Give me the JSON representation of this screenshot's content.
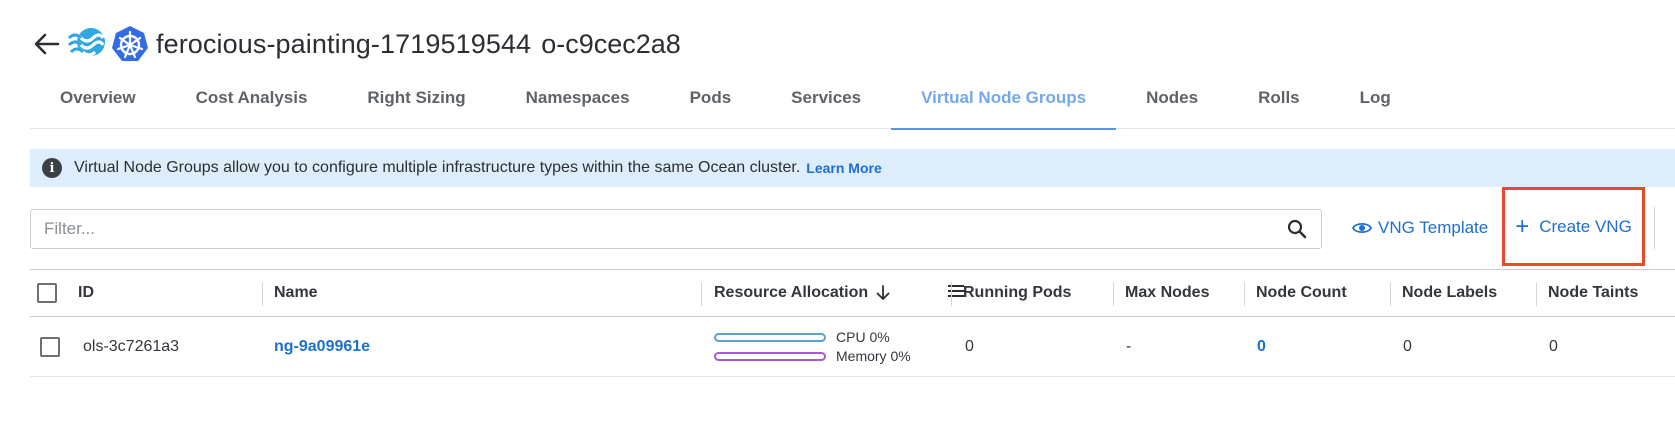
{
  "header": {
    "title": "ferocious-painting-1719519544",
    "subtitle": "o-c9cec2a8"
  },
  "tabs": [
    {
      "label": "Overview"
    },
    {
      "label": "Cost Analysis"
    },
    {
      "label": "Right Sizing"
    },
    {
      "label": "Namespaces"
    },
    {
      "label": "Pods"
    },
    {
      "label": "Services"
    },
    {
      "label": "Virtual Node Groups",
      "active": true
    },
    {
      "label": "Nodes"
    },
    {
      "label": "Rolls"
    },
    {
      "label": "Log"
    }
  ],
  "info": {
    "text": "Virtual Node Groups allow you to configure multiple infrastructure types within the same Ocean cluster.",
    "link": "Learn More"
  },
  "toolbar": {
    "filter_placeholder": "Filter...",
    "vng_template_label": "VNG Template",
    "create_vng_label": "Create VNG"
  },
  "table": {
    "columns": {
      "id": "ID",
      "name": "Name",
      "resource": "Resource Allocation",
      "running_pods": "Running Pods",
      "max_nodes": "Max Nodes",
      "node_count": "Node Count",
      "node_labels": "Node Labels",
      "node_taints": "Node Taints"
    },
    "rows": [
      {
        "id": "ols-3c7261a3",
        "name": "ng-9a09961e",
        "cpu": "CPU 0%",
        "memory": "Memory 0%",
        "running_pods": "0",
        "max_nodes": "-",
        "node_count": "0",
        "node_labels": "0",
        "node_taints": "0"
      }
    ]
  },
  "colors": {
    "accent": "#1d6fd1",
    "active_tab": "#73a8ec",
    "highlight_box": "#e8482c",
    "info_bg": "#ddedfb",
    "cpu_bar": "#5aa3c9",
    "memory_bar": "#a35bd6"
  },
  "icons": {
    "back": "arrow-left-icon",
    "logo": "ocean-waves-icon",
    "k8s": "kubernetes-icon",
    "info": "info-icon",
    "search": "search-icon",
    "eye": "eye-icon",
    "plus": "plus-icon",
    "sort": "arrow-down-icon",
    "menu": "menu-icon"
  }
}
